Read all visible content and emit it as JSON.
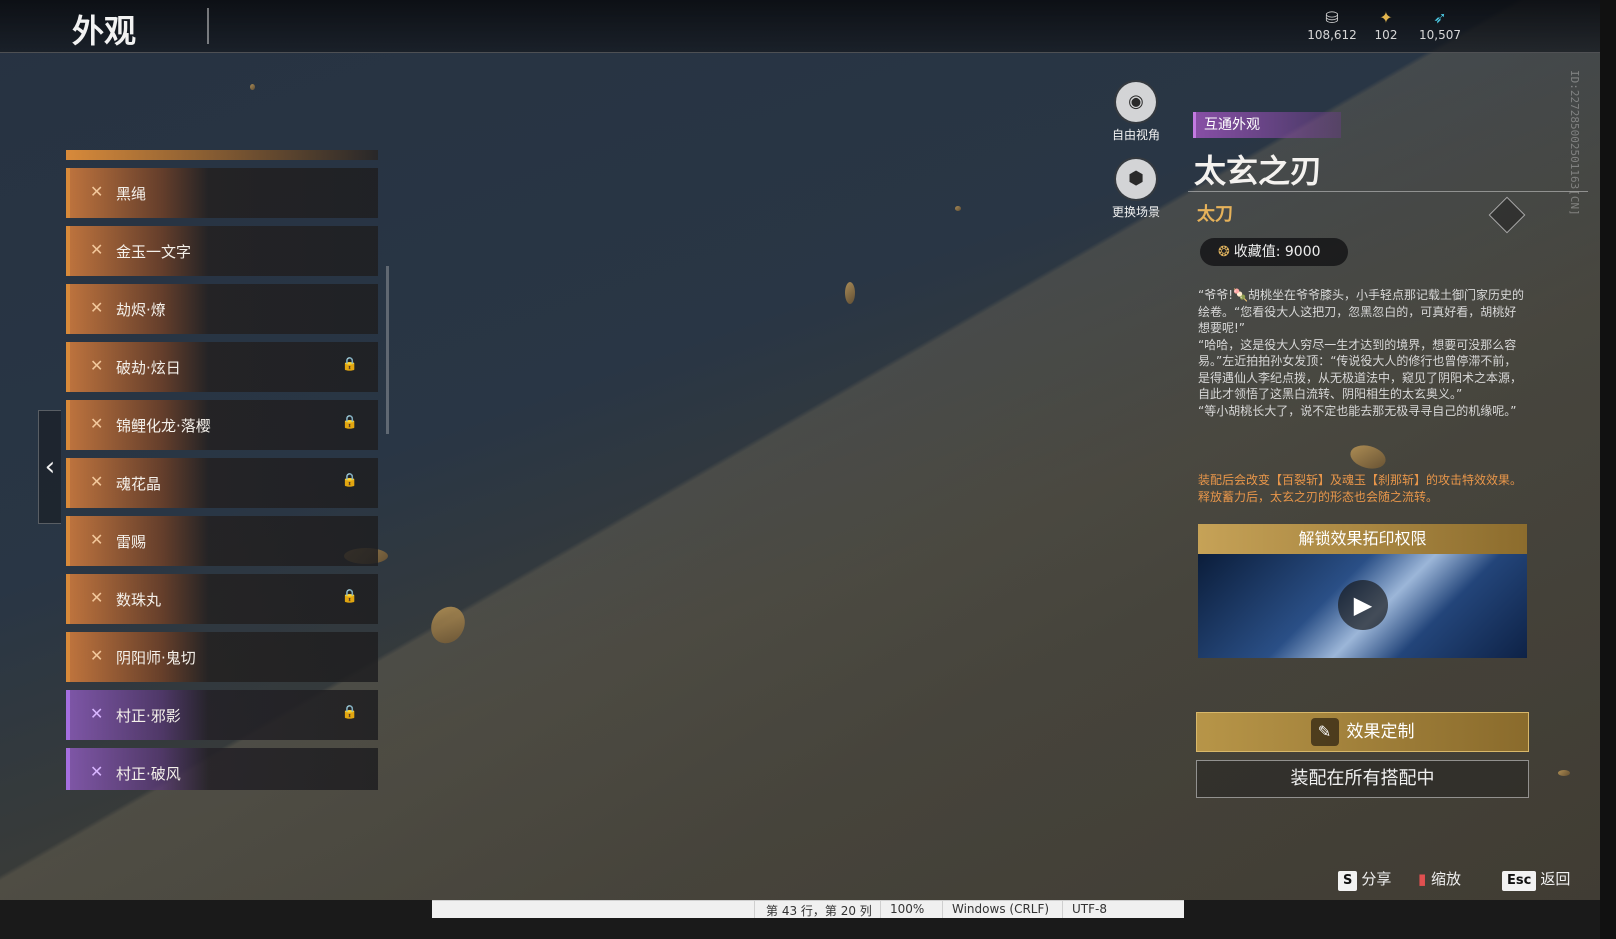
{
  "header": {
    "title": "外观"
  },
  "currencies": [
    {
      "icon": "coin-stack-icon",
      "value": "108,612"
    },
    {
      "icon": "gold-ticket-icon",
      "value": "102"
    },
    {
      "icon": "blue-feather-icon",
      "value": "10,507"
    }
  ],
  "uid": "ID:227285002501163[CN]",
  "list": [
    {
      "name": "黑绳",
      "locked": false,
      "rarity": "orange"
    },
    {
      "name": "金玉一文字",
      "locked": false,
      "rarity": "orange"
    },
    {
      "name": "劫烬·燎",
      "locked": false,
      "rarity": "orange"
    },
    {
      "name": "破劫·炫日",
      "locked": true,
      "rarity": "orange"
    },
    {
      "name": "锦鲤化龙·落樱",
      "locked": true,
      "rarity": "orange"
    },
    {
      "name": "魂花晶",
      "locked": true,
      "rarity": "orange"
    },
    {
      "name": "雷赐",
      "locked": false,
      "rarity": "orange"
    },
    {
      "name": "数珠丸",
      "locked": true,
      "rarity": "orange"
    },
    {
      "name": "阴阳师·鬼切",
      "locked": false,
      "rarity": "orange"
    },
    {
      "name": "村正·邪影",
      "locked": true,
      "rarity": "purple"
    },
    {
      "name": "村正·破风",
      "locked": false,
      "rarity": "purple"
    }
  ],
  "camera": {
    "free_view": "自由视角",
    "change_scene": "更换场景"
  },
  "detail": {
    "tag": "互通外观",
    "title": "太玄之刃",
    "type": "太刀",
    "collect_label": "收藏值: 9000",
    "description": "“爷爷!🍡胡桃坐在爷爷膝头，小手轻点那记载土御门家历史的绘卷。“您看役大人这把刀，忽黑忽白的，可真好看，胡桃好想要呢!”\n“哈哈，这是役大人穷尽一生才达到的境界，想要可没那么容易。”左近拍拍孙女发顶：“传说役大人的修行也曾停滞不前，是得遇仙人李纪点拨，从无极道法中，窥见了阴阳术之本源，自此才领悟了这黑白流转、阴阳相生的太玄奥义。”\n“等小胡桃长大了，说不定也能去那无极寻寻自己的机缘呢。”",
    "effect": "装配后会改变【百裂斩】及魂玉【刹那斩】的攻击特效效果。\n释放蓄力后，太玄之刃的形态也会随之流转。",
    "unlock_title": "解锁效果拓印权限",
    "custom_button": "效果定制",
    "equip_button": "装配在所有搭配中"
  },
  "hints": {
    "share_key": "S",
    "share": "分享",
    "zoom": "缩放",
    "back_key": "Esc",
    "back": "返回"
  },
  "notepad_status": {
    "position": "第 43 行，第 20 列",
    "zoom": "100%",
    "line_ending": "Windows (CRLF)",
    "encoding": "UTF-8"
  }
}
